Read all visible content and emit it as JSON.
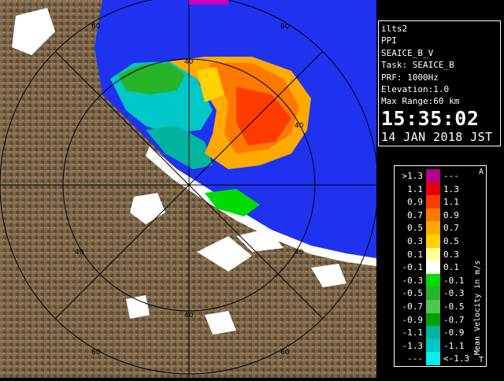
{
  "map": {
    "range_labels": {
      "r40_top": "40",
      "r60_topleft": "60",
      "r60_top": "60",
      "r40_right": "40",
      "r40_left": "40",
      "r40_lowerright": "40",
      "r40_bottom": "40",
      "r60_bottom": "60",
      "r60_bottomright": "60"
    }
  },
  "info": {
    "radar_name": "ilts2",
    "product": "PPI",
    "field": "SEAICE_B_V",
    "task": "Task: SEAICE_B",
    "prf": "PRF: 1000Hz",
    "elevation": "Elevation:1.0",
    "max_range": "Max Range:60 km",
    "time": "15:35:02",
    "date": "14 JAN 2018 JST"
  },
  "legend": {
    "unit_label": "Mean Velocity in m/s",
    "top_mark": "A",
    "bottom_mark": "T",
    "rows": [
      {
        "low": ">1.3",
        "high": "---",
        "color": "#b4008c"
      },
      {
        "low": "1.1",
        "high": "1.3",
        "color": "#e60000"
      },
      {
        "low": "0.9",
        "high": "1.1",
        "color": "#ff3c00"
      },
      {
        "low": "0.7",
        "high": "0.9",
        "color": "#ff7800"
      },
      {
        "low": "0.5",
        "high": "0.7",
        "color": "#ffaa00"
      },
      {
        "low": "0.3",
        "high": "0.5",
        "color": "#ffd200"
      },
      {
        "low": "0.1",
        "high": "0.3",
        "color": "#ffff96"
      },
      {
        "low": "-0.1",
        "high": "0.1",
        "color": "#ffffff"
      },
      {
        "low": "-0.3",
        "high": "-0.1",
        "color": "#00dc00"
      },
      {
        "low": "-0.5",
        "high": "-0.3",
        "color": "#28b428"
      },
      {
        "low": "-0.7",
        "high": "-0.5",
        "color": "#50c850"
      },
      {
        "low": "-0.9",
        "high": "-0.7",
        "color": "#00a000"
      },
      {
        "low": "-1.1",
        "high": "-0.9",
        "color": "#00b4a0"
      },
      {
        "low": "-1.3",
        "high": "-1.1",
        "color": "#00c8c8"
      },
      {
        "low": "---",
        "high": "<-1.3",
        "color": "#00f0f0"
      }
    ]
  },
  "colors": {
    "sea": "#1e32f0",
    "land": "#7a6448",
    "ring": "#000000",
    "coast": "#ffffff"
  }
}
